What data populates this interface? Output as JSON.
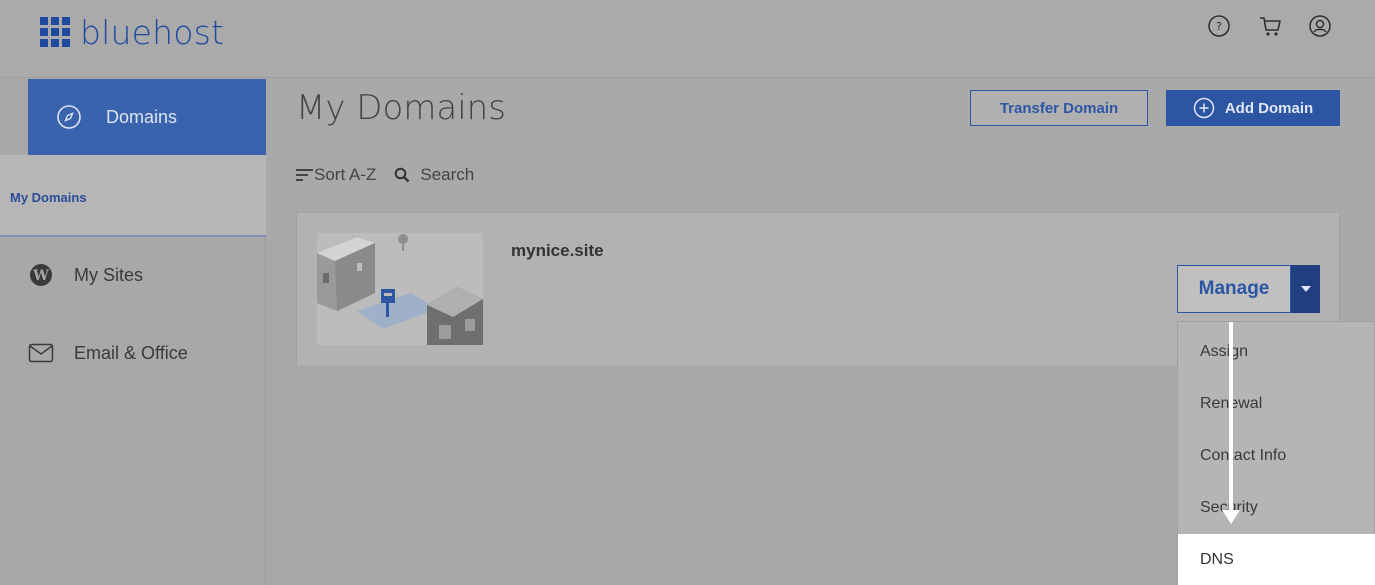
{
  "header": {
    "brand": "bluehost",
    "icons": [
      "help-icon",
      "cart-icon",
      "account-icon"
    ]
  },
  "sidebar": {
    "active_item": {
      "label": "Domains",
      "icon": "compass-icon"
    },
    "sub_item": {
      "label": "My Domains"
    },
    "items": [
      {
        "label": "My Sites",
        "icon": "wordpress-icon"
      },
      {
        "label": "Email & Office",
        "icon": "envelope-icon"
      }
    ]
  },
  "main": {
    "title": "My Domains",
    "transfer_label": "Transfer Domain",
    "add_label": "Add Domain",
    "sort_label": "Sort A-Z",
    "search_label": "Search",
    "domain_card": {
      "domain": "mynice.site",
      "manage_label": "Manage"
    },
    "dropdown": [
      "Assign",
      "Renewal",
      "Contact Info",
      "Security",
      "DNS"
    ],
    "dropdown_selected": "DNS"
  },
  "colors": {
    "brand": "#1e4aa0",
    "accent": "#2c56a4",
    "background": "#a9a9a9"
  }
}
